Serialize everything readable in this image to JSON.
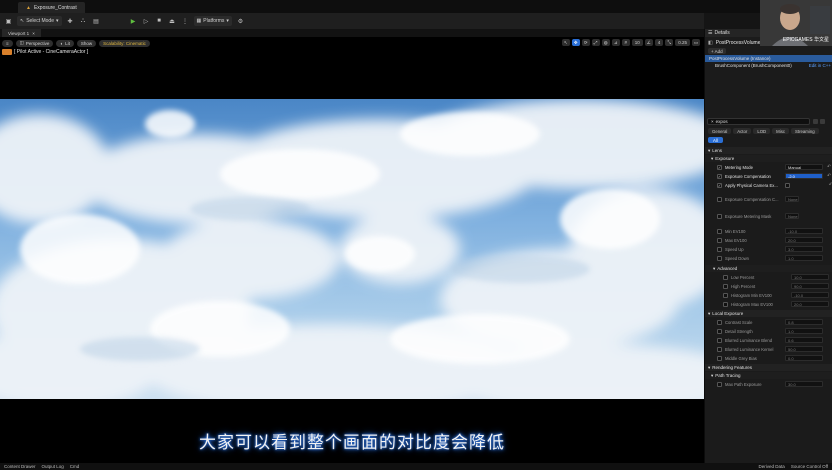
{
  "document_tab": {
    "title": "Exposure_Contrast"
  },
  "toolbar": {
    "select_mode": "Select Mode",
    "platforms": "Platforms"
  },
  "viewport_tab": {
    "title": "Viewport 1"
  },
  "viewport": {
    "perspective": "Perspective",
    "lit": "Lit",
    "show": "Show",
    "scalability": "Scalability: Cinematic",
    "num1": "10",
    "num2": "0.25",
    "num3": "4",
    "pilot": "[ Pilot Active - CineCameraActor ]"
  },
  "subtitle": "大家可以看到整个画面的对比度会降低",
  "bottombar": {
    "content_drawer": "Content Drawer",
    "output_log": "Output Log",
    "cmd": "Cmd",
    "derived_data": "Derived Data",
    "source_control": "Source Control Off"
  },
  "details": {
    "header": "Details",
    "component_title": "PostProcessVolume",
    "instance": "(Instance)",
    "add_button": "+ Add",
    "tree": [
      {
        "label": "PostProcessVolume (Instance)"
      },
      {
        "label": "BrushComponent (BrushComponent0)",
        "edit": "Edit in C++"
      }
    ],
    "search_value": "expos",
    "filter_tabs": [
      "General",
      "Actor",
      "LOD",
      "Misc",
      "Streaming"
    ],
    "all_tab": "All",
    "categories": {
      "lens": "Lens",
      "exposure": "Exposure",
      "advanced": "Advanced",
      "local_exposure": "Local Exposure",
      "rendering_features": "Rendering Features",
      "path_tracing": "Path Tracing"
    },
    "exposure_props": [
      {
        "label": "Metering Mode",
        "value": "Manual",
        "on": true
      },
      {
        "label": "Exposure Compensation",
        "value": "-2.0",
        "on": true,
        "selected": true
      },
      {
        "label": "Apply Physical Camera Ex...",
        "value": "",
        "on": true
      },
      {
        "label": "Exposure Compensation C...",
        "value": "None",
        "on": false
      },
      {
        "label": "Exposure Metering Mask",
        "value": "None",
        "on": false
      },
      {
        "label": "Min EV100",
        "value": "-10.0",
        "on": false
      },
      {
        "label": "Max EV100",
        "value": "20.0",
        "on": false
      },
      {
        "label": "Speed Up",
        "value": "3.0",
        "on": false
      },
      {
        "label": "Speed Down",
        "value": "1.0",
        "on": false
      }
    ],
    "advanced_props": [
      {
        "label": "Low Percent",
        "value": "10.0"
      },
      {
        "label": "High Percent",
        "value": "90.0"
      },
      {
        "label": "Histogram Min EV100",
        "value": "-10.0"
      },
      {
        "label": "Histogram Max EV100",
        "value": "20.0"
      }
    ],
    "local_exposure_props": [
      {
        "label": "Contrast Scale",
        "value": "0.8"
      },
      {
        "label": "Detail Strength",
        "value": "1.0"
      },
      {
        "label": "Blurred Luminance Blend",
        "value": "0.6"
      },
      {
        "label": "Blurred Luminance Kernel",
        "value": "50.0"
      },
      {
        "label": "Middle Grey Bias",
        "value": "0.0"
      }
    ],
    "path_tracing_props": [
      {
        "label": "Max Path Exposure",
        "value": "30.0"
      }
    ]
  },
  "webcam": {
    "label": "EPICGAMES 华文星"
  }
}
